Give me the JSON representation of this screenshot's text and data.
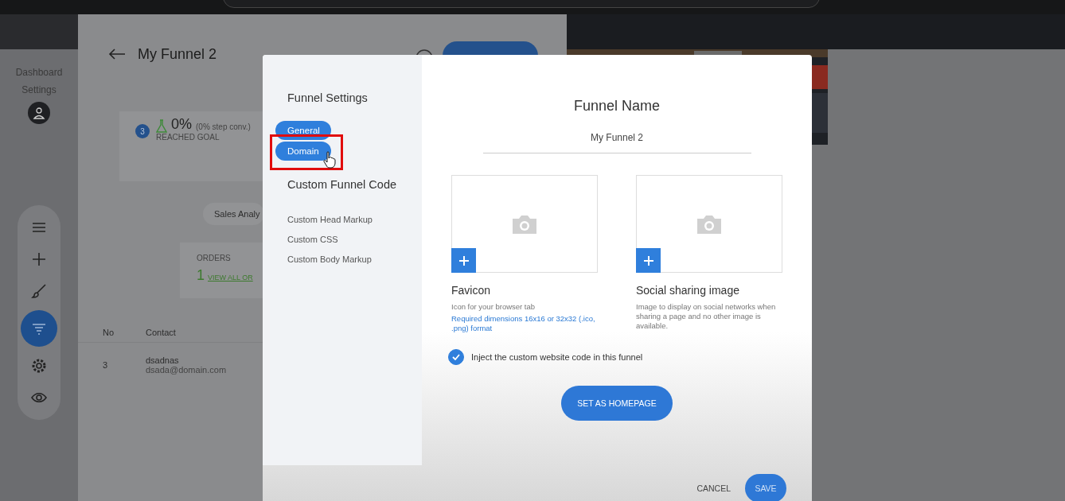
{
  "sidebar": {
    "items": [
      {
        "label": "Dashboard"
      },
      {
        "label": "Settings"
      }
    ]
  },
  "toolbar": {
    "tools": [
      {
        "kind": "menu",
        "selected": false
      },
      {
        "kind": "add",
        "selected": false
      },
      {
        "kind": "brush",
        "selected": false
      },
      {
        "kind": "funnel",
        "selected": true
      },
      {
        "kind": "settings",
        "selected": false
      },
      {
        "kind": "preview",
        "selected": false
      }
    ]
  },
  "page": {
    "title": "My Funnel 2",
    "step": {
      "badge": "3",
      "rate": "0%",
      "step_conv": "(0% step conv.)",
      "label": "REACHED GOAL"
    },
    "tab": "Sales Analy",
    "orders": {
      "label": "ORDERS",
      "count": "1",
      "link": "VIEW ALL OR"
    },
    "table": {
      "columns": [
        "No",
        "Contact"
      ],
      "rows": [
        {
          "no": "3",
          "name": "dsadnas",
          "email": "dsada@domain.com"
        }
      ]
    }
  },
  "modal": {
    "nav": {
      "title": "Funnel Settings",
      "tabs": [
        {
          "label": "General",
          "highlighted": false
        },
        {
          "label": "Domain",
          "highlighted": true
        }
      ],
      "code_title": "Custom Funnel Code",
      "code_links": [
        "Custom Head Markup",
        "Custom CSS",
        "Custom Body Markup"
      ]
    },
    "name_label": "Funnel Name",
    "name_value": "My Funnel 2",
    "uploads": [
      {
        "title": "Favicon",
        "description": "Icon for your browser tab",
        "note": "Required dimensions 16x16 or 32x32 (.ico, .png) format"
      },
      {
        "title": "Social sharing image",
        "description": "Image to display on social networks when sharing a page and no other image is available."
      }
    ],
    "inject": {
      "label": "Inject the custom website code in this funnel",
      "checked": true
    },
    "homepage_button": "SET AS HOMEPAGE",
    "cancel": "CANCEL",
    "save": "SAVE"
  }
}
